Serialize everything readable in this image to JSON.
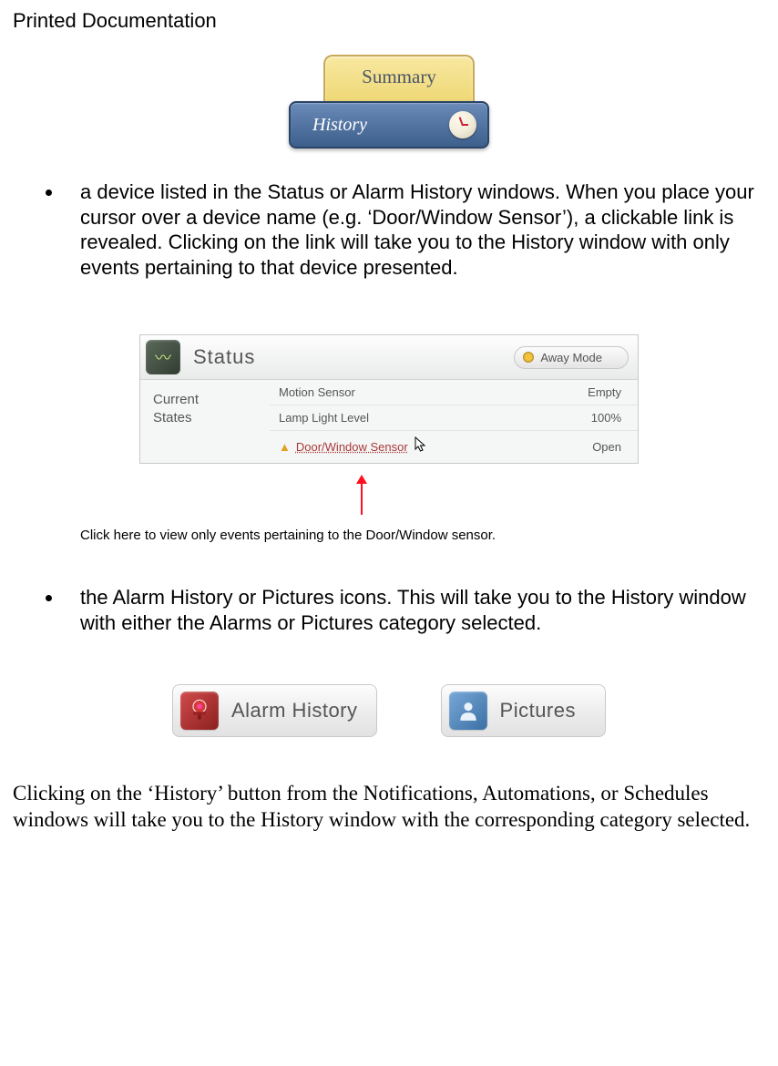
{
  "header": "Printed Documentation",
  "tabs": {
    "summary": "Summary",
    "history": "History"
  },
  "bullets": {
    "b1": "a device listed in the Status or Alarm History windows. When you place your cursor over a device name (e.g. ‘Door/Window Sensor’), a clickable link is revealed. Clicking on the link will take you to the History window with only events pertaining to that device presented.",
    "b2": "the Alarm History or Pictures icons. This will take you to the History window with either the Alarms or Pictures category selected."
  },
  "status": {
    "title": "Status",
    "mode": "Away Mode",
    "left1": "Current",
    "left2": "States",
    "rows": [
      {
        "name": "Motion Sensor",
        "value": "Empty"
      },
      {
        "name": "Lamp Light Level",
        "value": "100%"
      },
      {
        "name": "Door/Window Sensor",
        "value": "Open"
      }
    ]
  },
  "caption": "Click here to view only events pertaining to the Door/Window sensor.",
  "buttons": {
    "alarm": "Alarm History",
    "pictures": "Pictures"
  },
  "final": "Clicking on the ‘History’ button from the Notifications, Automations, or Schedules windows will take you to the History window with the corresponding category selected."
}
